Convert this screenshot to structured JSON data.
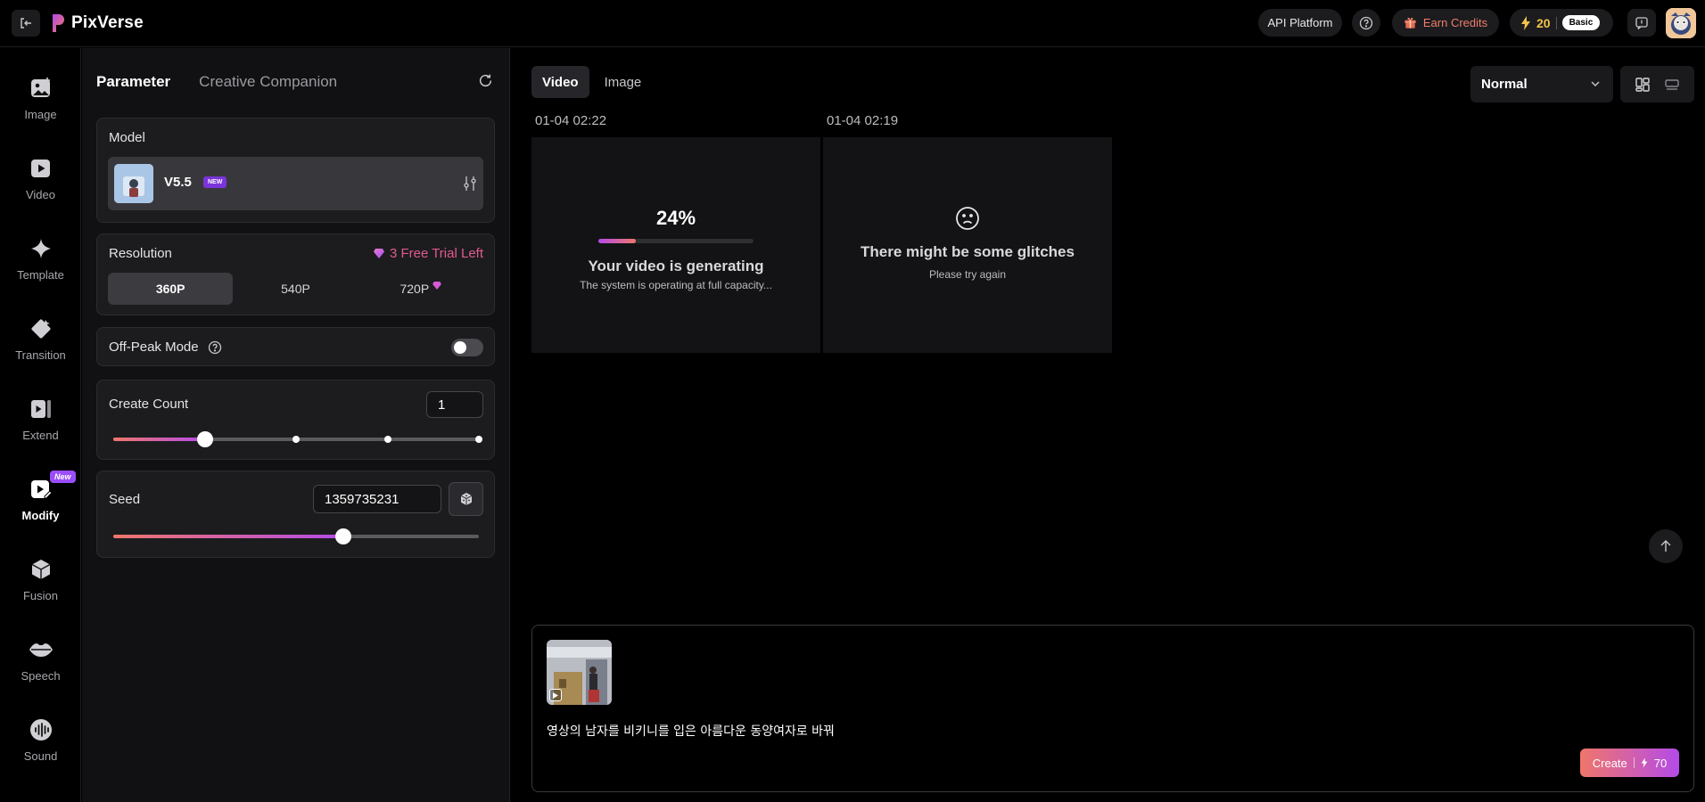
{
  "app": {
    "name": "PixVerse"
  },
  "topbar": {
    "api_platform": "API Platform",
    "earn_credits": "Earn Credits",
    "credits": "20",
    "plan": "Basic"
  },
  "nav": {
    "items": [
      {
        "label": "Image"
      },
      {
        "label": "Video"
      },
      {
        "label": "Template"
      },
      {
        "label": "Transition"
      },
      {
        "label": "Extend"
      },
      {
        "label": "Modify",
        "badge": "New"
      },
      {
        "label": "Fusion"
      },
      {
        "label": "Speech"
      },
      {
        "label": "Sound"
      }
    ],
    "active": "Modify"
  },
  "panel": {
    "tabs": [
      "Parameter",
      "Creative Companion"
    ],
    "model": {
      "label": "Model",
      "name": "V5.5",
      "badge": "NEW"
    },
    "resolution": {
      "label": "Resolution",
      "free_trial": "3 Free Trial Left",
      "options": [
        "360P",
        "540P",
        "720P"
      ],
      "selected": "360P"
    },
    "off_peak": {
      "label": "Off-Peak Mode",
      "enabled": false
    },
    "create_count": {
      "label": "Create Count",
      "value": "1",
      "slider_fraction": 0.25
    },
    "seed": {
      "label": "Seed",
      "value": "1359735231",
      "slider_fraction": 0.63
    }
  },
  "main": {
    "tabs": [
      "Video",
      "Image"
    ],
    "selected_tab": "Video",
    "quality": "Normal",
    "cards": [
      {
        "timestamp": "01-04 02:22",
        "percent": "24%",
        "progress": 0.24,
        "title": "Your video is generating",
        "subtitle": "The system is operating at full capacity..."
      },
      {
        "timestamp": "01-04 02:19",
        "title": "There might be some glitches",
        "subtitle": "Please try again"
      }
    ],
    "prompt": "영상의 남자를 비키니를 입은 아름다운 동양여자로 바꿔",
    "create": {
      "label": "Create",
      "cost": "70"
    }
  },
  "colors": {
    "accent_start": "#f0766a",
    "accent_end": "#b44be8",
    "credits": "#f3c34a"
  }
}
